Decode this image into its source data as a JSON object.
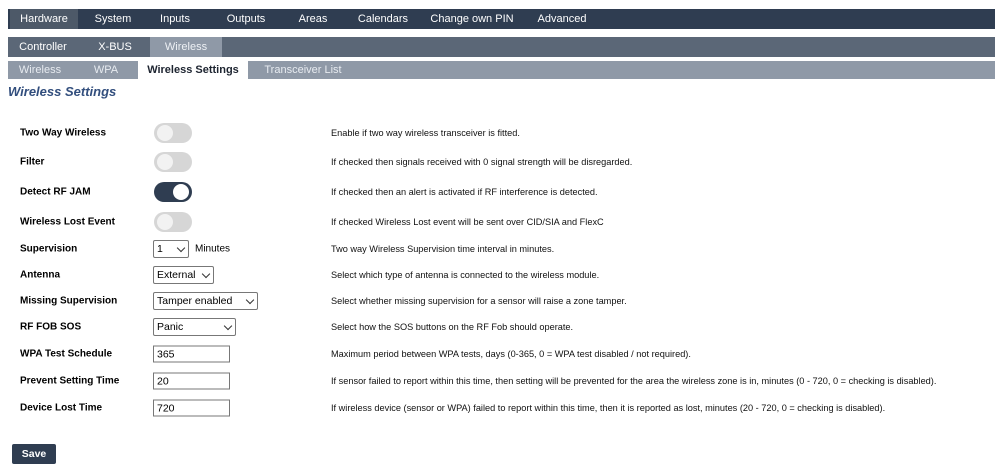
{
  "nav": {
    "main": [
      "Hardware",
      "System",
      "Inputs",
      "Outputs",
      "Areas",
      "Calendars",
      "Change own PIN",
      "Advanced"
    ],
    "sub": [
      "Controller",
      "X-BUS",
      "Wireless"
    ],
    "subsub": [
      "Wireless",
      "WPA",
      "Wireless Settings",
      "Transceiver List"
    ]
  },
  "page_title": "Wireless Settings",
  "settings": {
    "two_way_wireless": {
      "label": "Two Way Wireless",
      "enabled": false,
      "desc": "Enable if two way wireless transceiver is fitted."
    },
    "filter": {
      "label": "Filter",
      "enabled": false,
      "desc": "If checked then signals received with 0 signal strength will be disregarded."
    },
    "detect_rf_jam": {
      "label": "Detect RF JAM",
      "enabled": true,
      "desc": "If checked then an alert is activated if RF interference is detected."
    },
    "wireless_lost_event": {
      "label": "Wireless Lost Event",
      "enabled": false,
      "desc": "If checked Wireless Lost event will be sent over CID/SIA and FlexC"
    },
    "supervision": {
      "label": "Supervision",
      "value": "1",
      "unit": "Minutes",
      "desc": "Two way Wireless Supervision time interval in minutes."
    },
    "antenna": {
      "label": "Antenna",
      "value": "External",
      "desc": "Select which type of antenna is connected to the wireless module."
    },
    "missing_supervision": {
      "label": "Missing Supervision",
      "value": "Tamper enabled",
      "desc": "Select whether missing supervision for a sensor will raise a zone tamper."
    },
    "rf_fob_sos": {
      "label": "RF FOB SOS",
      "value": "Panic",
      "desc": "Select how the SOS buttons on the RF Fob should operate."
    },
    "wpa_test_schedule": {
      "label": "WPA Test Schedule",
      "value": "365",
      "desc": "Maximum period between WPA tests, days (0-365, 0 = WPA test disabled / not required)."
    },
    "prevent_setting_time": {
      "label": "Prevent Setting Time",
      "value": "20",
      "desc": "If sensor failed to report within this time, then setting will be prevented for the area the wireless zone is in, minutes (0 - 720, 0 = checking is disabled)."
    },
    "device_lost_time": {
      "label": "Device Lost Time",
      "value": "720",
      "desc": "If wireless device (sensor or WPA) failed to report within this time, then it is reported as lost, minutes (20 - 720, 0 = checking is disabled)."
    }
  },
  "save_label": "Save"
}
